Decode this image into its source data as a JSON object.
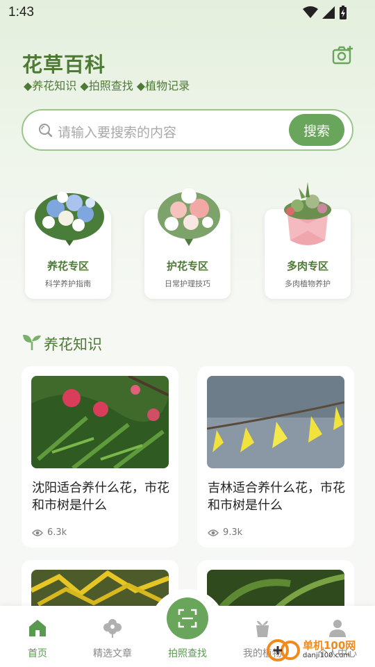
{
  "status_bar": {
    "time": "1:43"
  },
  "header": {
    "title": "花草百科",
    "subtitle": "◆养花知识 ◆拍照查找 ◆植物记录",
    "camera_icon": "camera-add-icon"
  },
  "search": {
    "placeholder": "请输入要搜索的内容",
    "button_label": "搜索"
  },
  "categories": [
    {
      "title": "养花专区",
      "subtitle": "科学养护指南"
    },
    {
      "title": "护花专区",
      "subtitle": "日常护理技巧"
    },
    {
      "title": "多肉专区",
      "subtitle": "多肉植物养护"
    }
  ],
  "section": {
    "title": "养花知识"
  },
  "articles": [
    {
      "title": "沈阳适合养什么花，市花和市树是什么",
      "views": "6.3k"
    },
    {
      "title": "吉林适合养什么花，市花和市树是什么",
      "views": "9.3k"
    }
  ],
  "nav": [
    {
      "label": "首页"
    },
    {
      "label": "精选文章"
    },
    {
      "label": "拍照查找"
    },
    {
      "label": "我的植物"
    },
    {
      "label": "个人中心"
    }
  ],
  "watermark": {
    "text": "单机100网",
    "url": "danji100.com"
  },
  "colors": {
    "accent": "#6aa55c",
    "brand": "#4d7a35"
  }
}
